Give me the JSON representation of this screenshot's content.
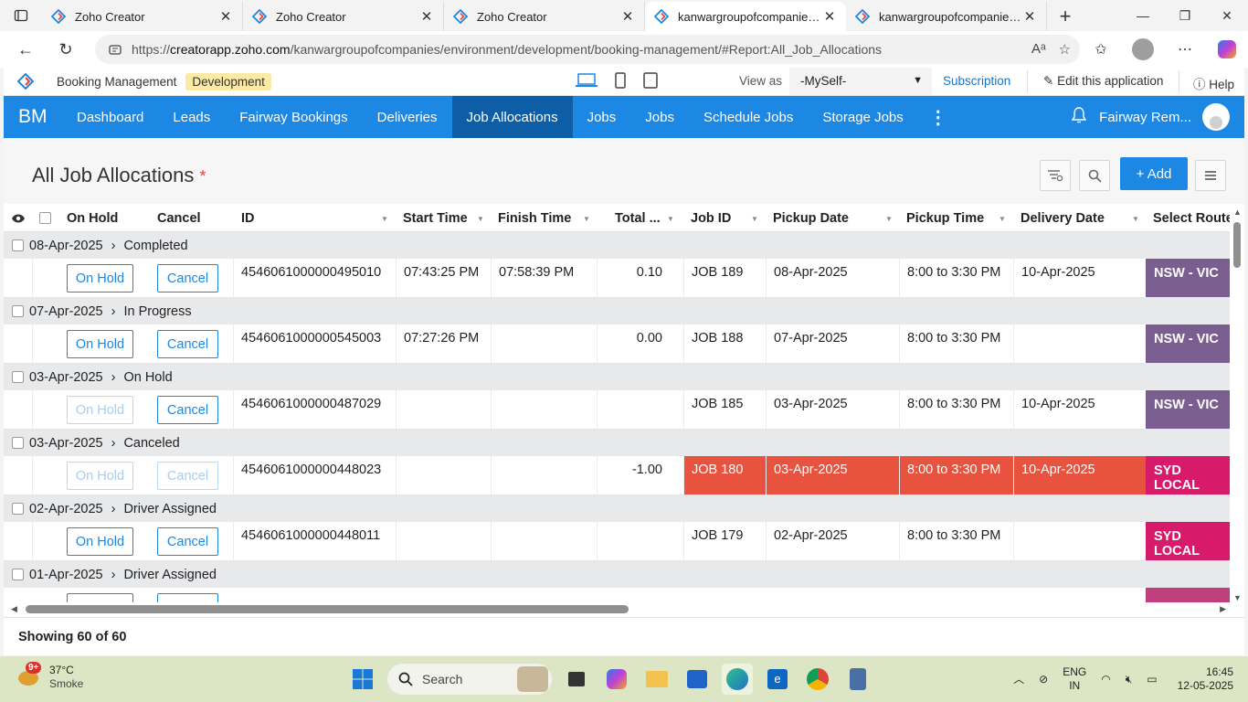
{
  "browser": {
    "tabs": [
      {
        "title": "Zoho Creator",
        "active": false
      },
      {
        "title": "Zoho Creator",
        "active": false
      },
      {
        "title": "Zoho Creator",
        "active": false
      },
      {
        "title": "kanwargroupofcompanies - B",
        "active": true
      },
      {
        "title": "kanwargroupofcompanies - B",
        "active": false
      }
    ],
    "url_prefix": "https://",
    "url_host": "creatorapp.zoho.com",
    "url_path": "/kanwargroupofcompanies/environment/development/booking-management/#Report:All_Job_Allocations"
  },
  "app_header": {
    "app_name": "Booking Management",
    "environment": "Development",
    "view_as_label": "View as",
    "view_as_value": "-MySelf-",
    "subscription": "Subscription",
    "edit_app": "Edit this application",
    "help": "Help"
  },
  "menu": {
    "brand": "BM",
    "items": [
      "Dashboard",
      "Leads",
      "Fairway Bookings",
      "Deliveries",
      "Job Allocations",
      "Jobs",
      "Jobs",
      "Schedule Jobs",
      "Storage Jobs"
    ],
    "active_index": 4,
    "user_name": "Fairway Rem..."
  },
  "report": {
    "title": "All Job Allocations",
    "required_mark": "*",
    "add_label": "+ Add",
    "columns": [
      "On Hold",
      "Cancel",
      "ID",
      "Start Time",
      "Finish Time",
      "Total ...",
      "Job ID",
      "Pickup Date",
      "Pickup Time",
      "Delivery Date",
      "Select Route"
    ],
    "groups": [
      {
        "date": "08-Apr-2025",
        "status": "Completed",
        "row": {
          "onhold": "On Hold",
          "onhold_disabled": false,
          "cancel": "Cancel",
          "cancel_disabled": false,
          "id": "4546061000000495010",
          "start": "07:43:25 PM",
          "finish": "07:58:39 PM",
          "total": "0.10",
          "job_id": "JOB 189",
          "pickup_date": "08-Apr-2025",
          "pickup_time": "8:00 to 3:30 PM",
          "delivery_date": "10-Apr-2025",
          "route": "NSW - VIC",
          "route_color": "#7b5e90",
          "highlight": false
        }
      },
      {
        "date": "07-Apr-2025",
        "status": "In Progress",
        "row": {
          "onhold": "On Hold",
          "onhold_disabled": false,
          "cancel": "Cancel",
          "cancel_disabled": false,
          "id": "4546061000000545003",
          "start": "07:27:26 PM",
          "finish": "",
          "total": "0.00",
          "job_id": "JOB 188",
          "pickup_date": "07-Apr-2025",
          "pickup_time": "8:00 to 3:30 PM",
          "delivery_date": "",
          "route": "NSW - VIC",
          "route_color": "#7b5e90",
          "highlight": false
        }
      },
      {
        "date": "03-Apr-2025",
        "status": "On Hold",
        "row": {
          "onhold": "On Hold",
          "onhold_disabled": true,
          "cancel": "Cancel",
          "cancel_disabled": false,
          "id": "4546061000000487029",
          "start": "",
          "finish": "",
          "total": "",
          "job_id": "JOB 185",
          "pickup_date": "03-Apr-2025",
          "pickup_time": "8:00 to 3:30 PM",
          "delivery_date": "10-Apr-2025",
          "route": "NSW - VIC",
          "route_color": "#7b5e90",
          "highlight": false
        }
      },
      {
        "date": "03-Apr-2025",
        "status": "Canceled",
        "row": {
          "onhold": "On Hold",
          "onhold_disabled": true,
          "cancel": "Cancel",
          "cancel_disabled": true,
          "id": "4546061000000448023",
          "start": "",
          "finish": "",
          "total": "-1.00",
          "job_id": "JOB 180",
          "pickup_date": "03-Apr-2025",
          "pickup_time": "8:00 to 3:30 PM",
          "delivery_date": "10-Apr-2025",
          "route": "SYD LOCAL",
          "route_color": "#d81a6a",
          "highlight": true
        }
      },
      {
        "date": "02-Apr-2025",
        "status": "Driver Assigned",
        "row": {
          "onhold": "On Hold",
          "onhold_disabled": false,
          "cancel": "Cancel",
          "cancel_disabled": false,
          "id": "4546061000000448011",
          "start": "",
          "finish": "",
          "total": "",
          "job_id": "JOB 179",
          "pickup_date": "02-Apr-2025",
          "pickup_time": "8:00 to 3:30 PM",
          "delivery_date": "",
          "route": "SYD LOCAL",
          "route_color": "#d81a6a",
          "highlight": false
        }
      },
      {
        "date": "01-Apr-2025",
        "status": "Driver Assigned",
        "row": null
      }
    ],
    "footer": "Showing 60 of 60"
  },
  "taskbar": {
    "badge": "9+",
    "temperature": "37°C",
    "weather": "Smoke",
    "search_placeholder": "Search",
    "lang_top": "ENG",
    "lang_bottom": "IN",
    "time": "16:45",
    "date": "12-05-2025"
  },
  "colors": {
    "accent": "#1d87e4",
    "menu_active": "#0d5ea6",
    "canceled_row": "#e8533f",
    "route_nsw_vic": "#7b5e90",
    "route_syd_local": "#d81a6a"
  }
}
